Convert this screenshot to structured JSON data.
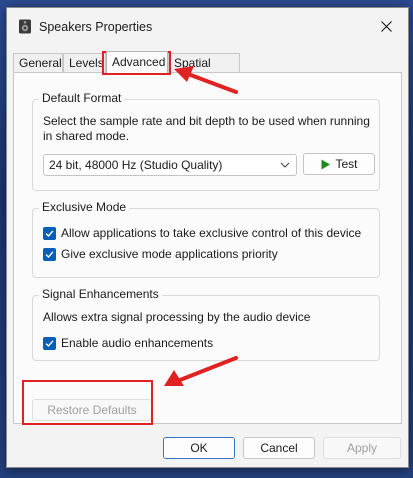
{
  "window": {
    "title": "Speakers Properties"
  },
  "tabs": [
    {
      "label": "General"
    },
    {
      "label": "Levels"
    },
    {
      "label": "Advanced"
    },
    {
      "label": "Spatial sound"
    }
  ],
  "default_format": {
    "title": "Default Format",
    "description": "Select the sample rate and bit depth to be used when running in shared mode.",
    "selected_format": "24 bit, 48000 Hz (Studio Quality)",
    "test_label": "Test"
  },
  "exclusive_mode": {
    "title": "Exclusive Mode",
    "options": [
      {
        "label": "Allow applications to take exclusive control of this device",
        "checked": true
      },
      {
        "label": "Give exclusive mode applications priority",
        "checked": true
      }
    ]
  },
  "signal_enhancements": {
    "title": "Signal Enhancements",
    "description": "Allows extra signal processing by the audio device",
    "option": {
      "label": "Enable audio enhancements",
      "checked": true
    }
  },
  "restore_defaults_label": "Restore Defaults",
  "footer": {
    "ok": "OK",
    "cancel": "Cancel",
    "apply": "Apply"
  },
  "colors": {
    "accent": "#005fb8",
    "highlight": "#e02222",
    "test_icon": "#1e8a1e"
  }
}
